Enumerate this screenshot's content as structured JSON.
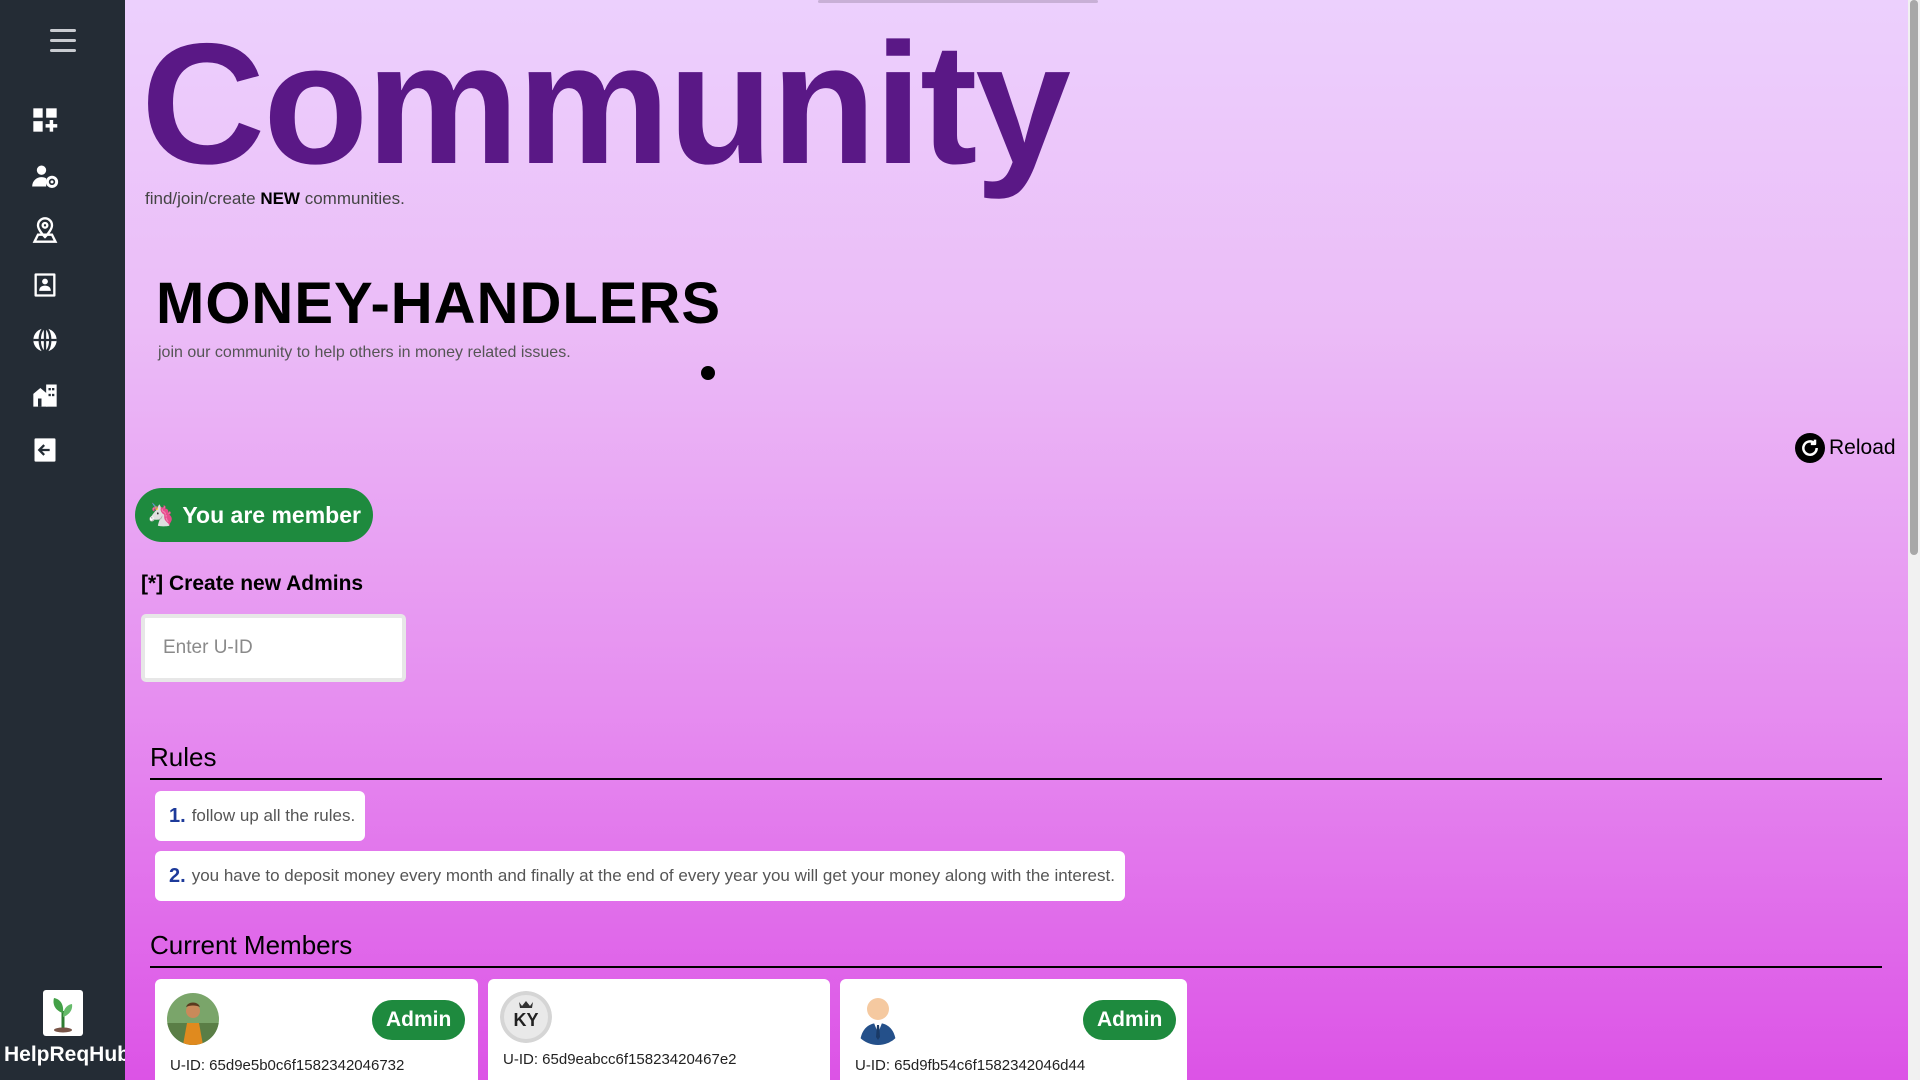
{
  "app": {
    "brand_name": "HelpReqHub"
  },
  "sidebar": {
    "icons": [
      "menu-icon",
      "dashboard-add-icon",
      "user-settings-icon",
      "location-user-icon",
      "contact-book-icon",
      "globe-icon",
      "buildings-icon",
      "logout-icon"
    ]
  },
  "hero": {
    "title": "Community",
    "subtitle_pre": "find/join/create",
    "subtitle_bold": "NEW",
    "subtitle_post": "communities."
  },
  "community": {
    "name": "MONEY-HANDLERS",
    "description": "join our community to help others in money related issues."
  },
  "reload": {
    "label": "Reload"
  },
  "membership": {
    "badge_label": "You are member",
    "badge_emoji": "🦄"
  },
  "admin_form": {
    "title": "[*] Create new Admins",
    "placeholder": "Enter U-ID"
  },
  "rules": {
    "title": "Rules",
    "items": [
      {
        "num": "1.",
        "text": "follow up all the rules."
      },
      {
        "num": "2.",
        "text": "you have to deposit money every month and finally at the end of every year you will get your money along with the interest."
      }
    ]
  },
  "members": {
    "title": "Current Members",
    "items": [
      {
        "uid": "U-ID: 65d9e5b0c6f1582342046732",
        "badge": "Admin"
      },
      {
        "uid": "U-ID: 65d9eabcc6f15823420467e2",
        "badge": ""
      },
      {
        "uid": "U-ID: 65d9fb54c6f1582342046d44",
        "badge": "Admin"
      }
    ]
  },
  "colors": {
    "sidebar_bg": "#242c35",
    "title_purple": "#5a1886",
    "badge_green": "#1e8a3e",
    "rule_num_blue": "#1d3a9a"
  }
}
